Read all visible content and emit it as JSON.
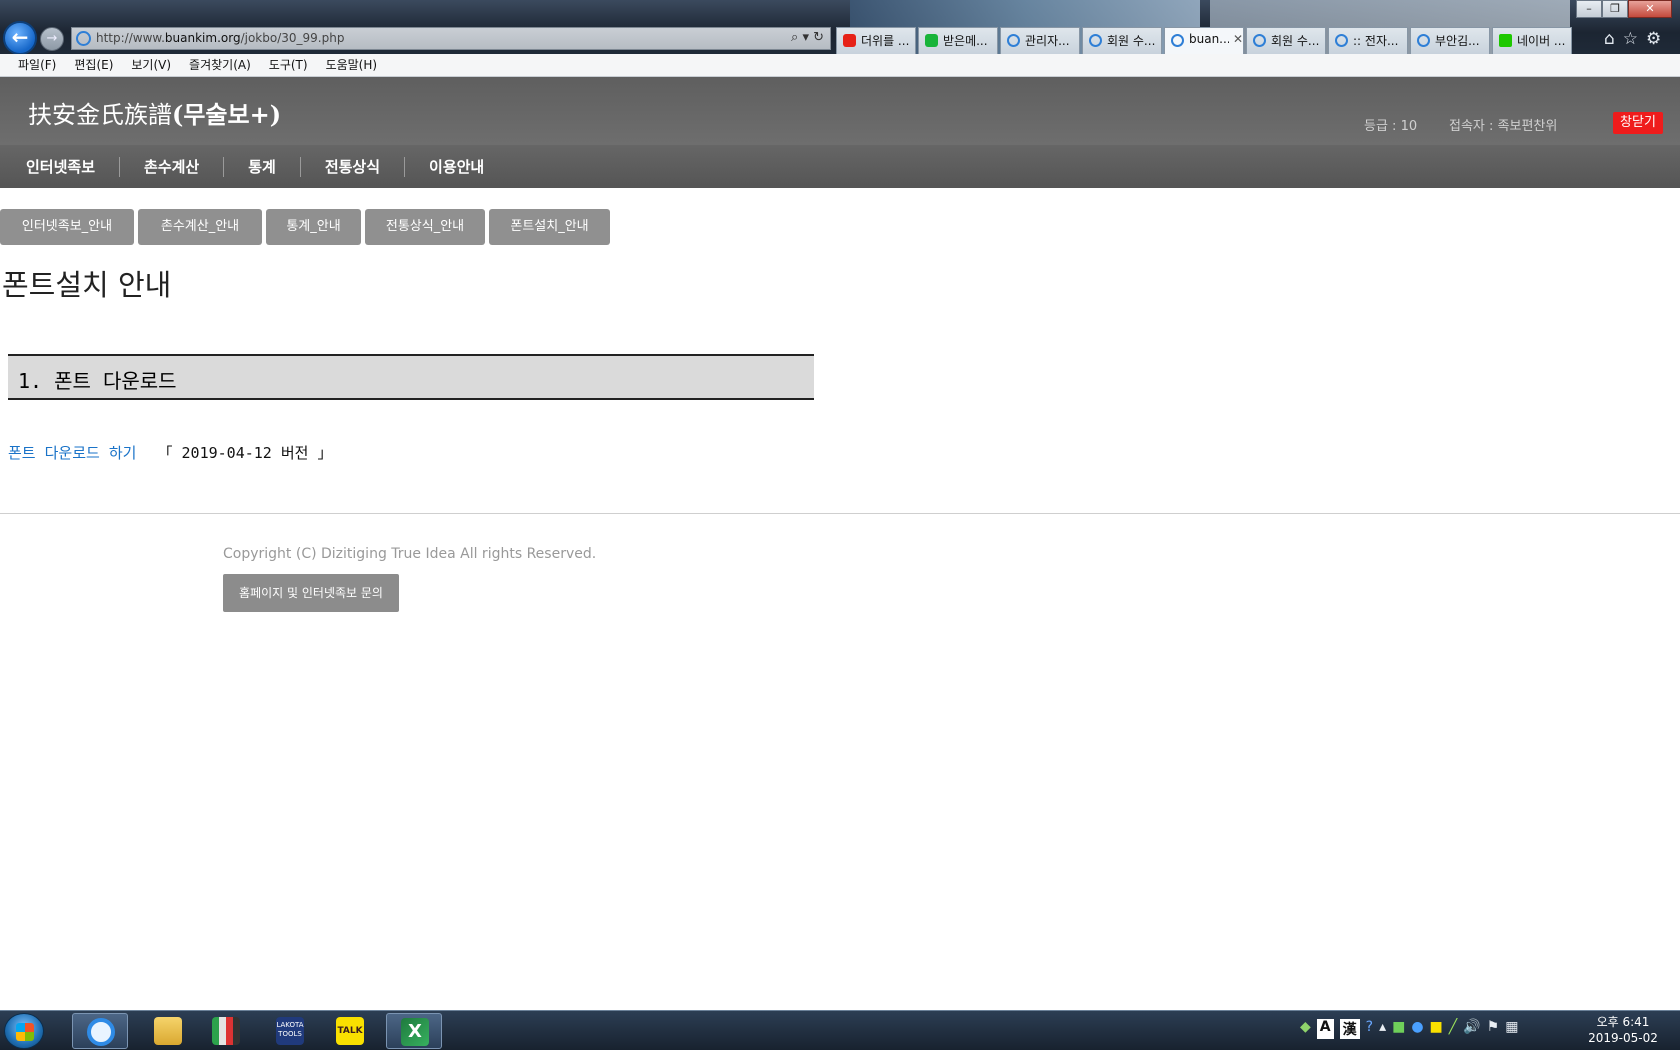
{
  "browser": {
    "url_prefix": "http://www.",
    "url_domain": "buankim.org",
    "url_path": "/jokbo/30_99.php",
    "address_tools": "⌕ ▾ ↻",
    "back_glyph": "←",
    "forward_glyph": "→",
    "tabs": [
      {
        "label": "더위를 ...",
        "icon": "youtube-icon",
        "active": false
      },
      {
        "label": "받은메...",
        "icon": "mail-icon",
        "active": false
      },
      {
        "label": "관리자...",
        "icon": "ie-icon",
        "active": false
      },
      {
        "label": "회원 수...",
        "icon": "ie-icon",
        "active": false
      },
      {
        "label": "buan...",
        "icon": "ie-icon",
        "active": true
      },
      {
        "label": "회원 수...",
        "icon": "ie-icon",
        "active": false
      },
      {
        "label": ":: 전자...",
        "icon": "ie-icon",
        "active": false
      },
      {
        "label": "부안김...",
        "icon": "ie-icon",
        "active": false
      },
      {
        "label": "네이버 ...",
        "icon": "naver-icon",
        "active": false
      }
    ],
    "tab_close_glyph": "✕",
    "window_buttons": {
      "minimize": "–",
      "restore": "❐",
      "close": "✕"
    },
    "chrome_icons": {
      "home": "⌂",
      "favorites": "☆",
      "settings": "⚙"
    },
    "menu": [
      "파일(F)",
      "편집(E)",
      "보기(V)",
      "즐겨찾기(A)",
      "도구(T)",
      "도움말(H)"
    ]
  },
  "site": {
    "title_hanja": "扶安金氏族譜",
    "title_sub": "(무술보+)",
    "grade": "등급 : 10",
    "user": "접속자 : 족보편찬위",
    "close_button": "창닫기",
    "nav": [
      "인터넷족보",
      "촌수계산",
      "통계",
      "전통상식",
      "이용안내"
    ],
    "subnav": [
      "인터넷족보_안내",
      "촌수계산_안내",
      "통계_안내",
      "전통상식_안내",
      "폰트설치_안내"
    ],
    "page_title": "폰트설치 안내",
    "section_title": "1. 폰트 다운로드",
    "download_link": "폰트 다운로드 하기",
    "download_version": "「 2019-04-12 버전 」",
    "copyright": "Copyright (C) Dizitiging True Idea All rights Reserved.",
    "inquiry_button": "홈페이지 및 인터넷족보 문의"
  },
  "taskbar": {
    "apps": [
      "internet-explorer",
      "file-explorer",
      "excel-tools",
      "lakota-tools",
      "kakaotalk",
      "excel"
    ],
    "kakao_label": "TALK",
    "lakota_label": "LAKOTA TOOLS",
    "tray": {
      "ime_a": "A",
      "ime_han": "漢",
      "help": "?",
      "volume": "🔊",
      "flag": "⚑"
    },
    "time": "오후 6:41",
    "date": "2019-05-02"
  },
  "colors": {
    "header_bg": "#666666",
    "close_red": "#ef1c1c",
    "link_blue": "#1a73c8",
    "subnav_gray": "#909090"
  }
}
